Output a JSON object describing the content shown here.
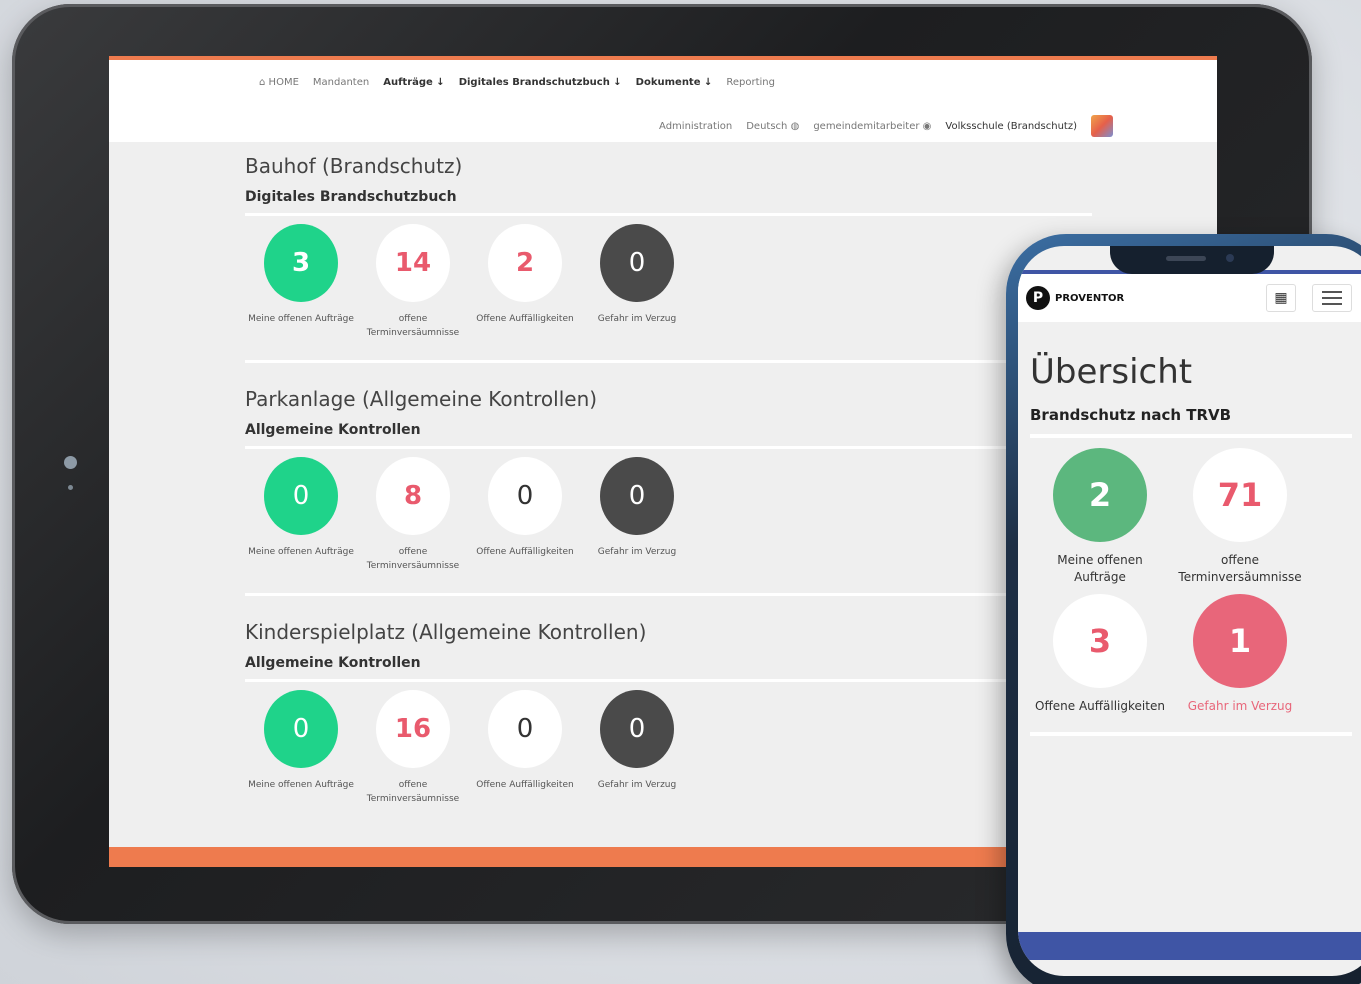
{
  "tablet": {
    "nav": {
      "home": "HOME",
      "mandanten": "Mandanten",
      "auftraege": "Aufträge ↓",
      "brandschutzbuch": "Digitales Brandschutzbuch ↓",
      "dokumente": "Dokumente ↓",
      "reporting": "Reporting",
      "administration": "Administration",
      "language": "Deutsch",
      "user": "gemeindemitarbeiter",
      "tenant": "Volksschule (Brandschutz)"
    },
    "sections": [
      {
        "title": "Bauhof (Brandschutz)",
        "subtitle": "Digitales Brandschutzbuch",
        "stats": [
          {
            "value": "3",
            "label": "Meine offenen Aufträge"
          },
          {
            "value": "14",
            "label": "offene Terminversäumnisse"
          },
          {
            "value": "2",
            "label": "Offene Auffälligkeiten"
          },
          {
            "value": "0",
            "label": "Gefahr im Verzug"
          }
        ]
      },
      {
        "title": "Parkanlage (Allgemeine Kontrollen)",
        "subtitle": "Allgemeine Kontrollen",
        "stats": [
          {
            "value": "0",
            "label": "Meine offenen Aufträge"
          },
          {
            "value": "8",
            "label": "offene Terminversäumnisse"
          },
          {
            "value": "0",
            "label": "Offene Auffälligkeiten"
          },
          {
            "value": "0",
            "label": "Gefahr im Verzug"
          }
        ]
      },
      {
        "title": "Kinderspielplatz (Allgemeine Kontrollen)",
        "subtitle": "Allgemeine Kontrollen",
        "stats": [
          {
            "value": "0",
            "label": "Meine offenen Aufträge"
          },
          {
            "value": "16",
            "label": "offene Terminversäumnisse"
          },
          {
            "value": "0",
            "label": "Offene Auffälligkeiten"
          },
          {
            "value": "0",
            "label": "Gefahr im Verzug"
          }
        ]
      }
    ]
  },
  "phone": {
    "brand": "PROVENTOR",
    "title": "Übersicht",
    "subtitle": "Brandschutz nach TRVB",
    "stats": [
      {
        "value": "2",
        "label": "Meine offenen Aufträge"
      },
      {
        "value": "71",
        "label": "offene Terminversäumnisse"
      },
      {
        "value": "3",
        "label": "Offene Auffälligkeiten"
      },
      {
        "value": "1",
        "label": "Gefahr im Verzug"
      }
    ]
  },
  "colors": {
    "accent_orange": "#ee7b4e",
    "green": "#1fd38a",
    "red_text": "#e95a6d",
    "dark_circle": "#4a4a4a",
    "phone_blue": "#3f55a5"
  }
}
